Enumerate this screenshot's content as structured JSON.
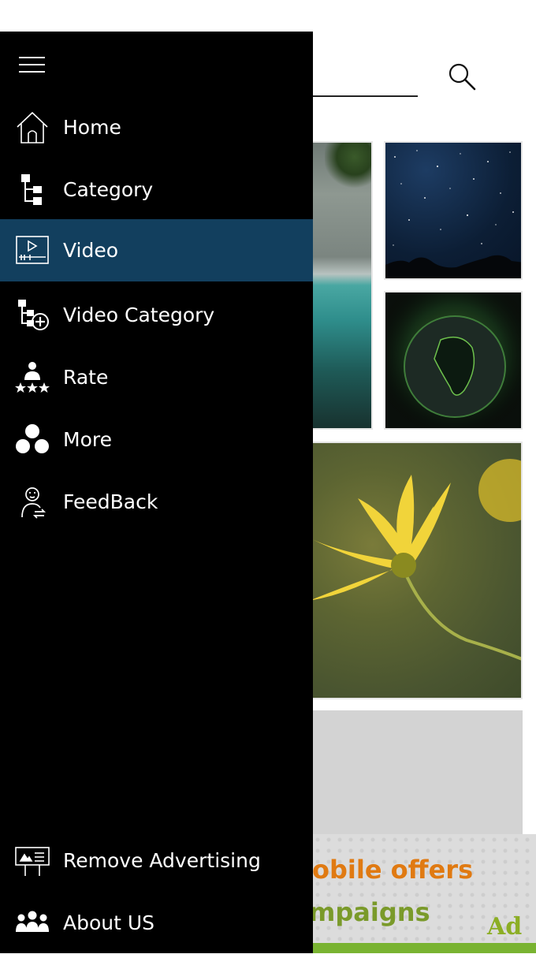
{
  "menu": {
    "items": [
      {
        "label": "Home",
        "icon": "home-icon"
      },
      {
        "label": "Category",
        "icon": "category-tree-icon"
      },
      {
        "label": "Video",
        "icon": "video-player-icon",
        "active": true
      },
      {
        "label": "Video Category",
        "icon": "video-category-add-icon"
      },
      {
        "label": "Rate",
        "icon": "rate-stars-icon"
      },
      {
        "label": "More",
        "icon": "more-circles-icon"
      },
      {
        "label": "FeedBack",
        "icon": "feedback-person-icon"
      }
    ],
    "footer_items": [
      {
        "label": "Remove Advertising",
        "icon": "billboard-icon"
      },
      {
        "label": "About US",
        "icon": "group-people-icon"
      }
    ]
  },
  "ad": {
    "line1": "obile offers",
    "line2": "mpaigns",
    "logo": "Ad I"
  },
  "colors": {
    "drawer_bg": "#000000",
    "active_item": "#123f5e",
    "text": "#ffffff"
  }
}
